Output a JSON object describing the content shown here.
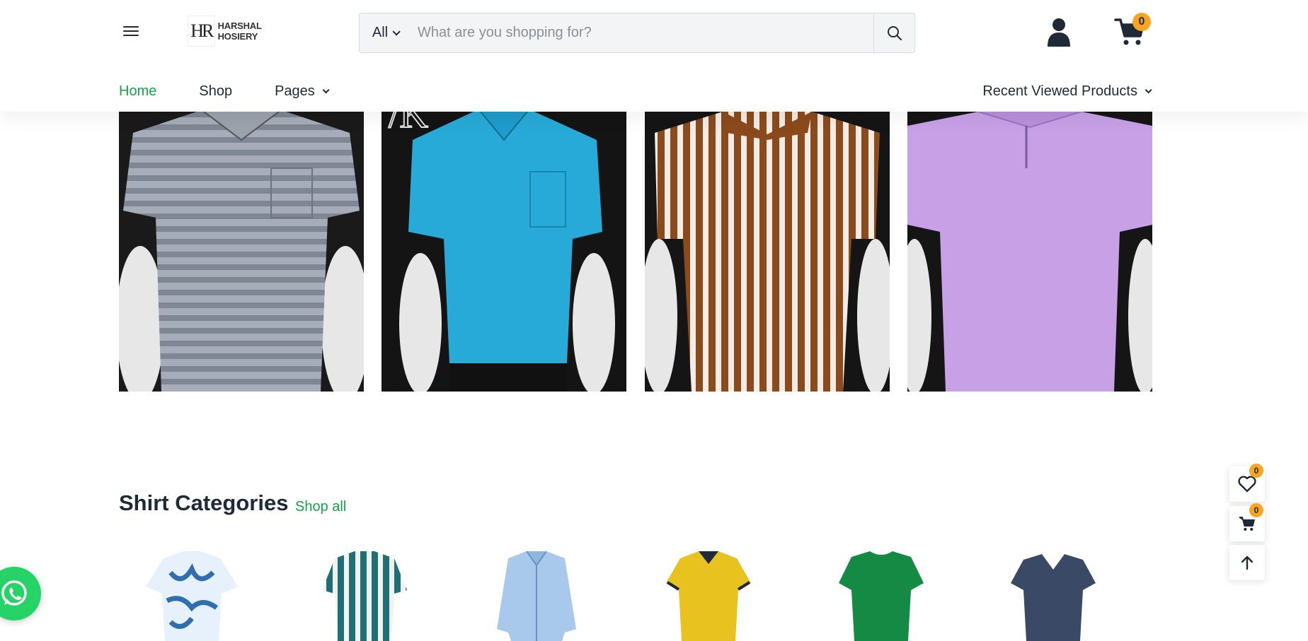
{
  "brand": {
    "logo_mark": "HR",
    "logo_text": "HARSHAL HOSIERY"
  },
  "search": {
    "category": "All",
    "placeholder": "What are you shopping for?"
  },
  "cart": {
    "count": "0"
  },
  "nav": {
    "items": [
      {
        "label": "Home",
        "active": true
      },
      {
        "label": "Shop",
        "active": false
      },
      {
        "label": "Pages",
        "active": false,
        "dropdown": true
      }
    ],
    "recent_label": "Recent Viewed Products"
  },
  "products": [
    {
      "name": "grey striped polo",
      "color": "#9aa0ab"
    },
    {
      "name": "sky blue polo",
      "color": "#26a9d6"
    },
    {
      "name": "brown vertical stripe polo",
      "color": "#8b4a1c"
    },
    {
      "name": "lavender polo",
      "color": "#c7a0e6"
    }
  ],
  "categories_section": {
    "title": "Shirt Categories",
    "shop_all": "Shop all",
    "items": [
      {
        "name": "printed-shirt",
        "color": "#3b82c4"
      },
      {
        "name": "striped-shirt",
        "color": "#1f6f74"
      },
      {
        "name": "formal-shirt",
        "color": "#a9c9ec"
      },
      {
        "name": "polo-tshirt",
        "color": "#e8c21e"
      },
      {
        "name": "round-neck-tshirt",
        "color": "#148a45"
      },
      {
        "name": "v-neck-tshirt",
        "color": "#3a4a66"
      }
    ]
  },
  "floating": {
    "wishlist_count": "0",
    "cart_count": "0"
  },
  "colors": {
    "accent": "#16a34a",
    "badge": "#f6a623",
    "whatsapp": "#25d366"
  }
}
